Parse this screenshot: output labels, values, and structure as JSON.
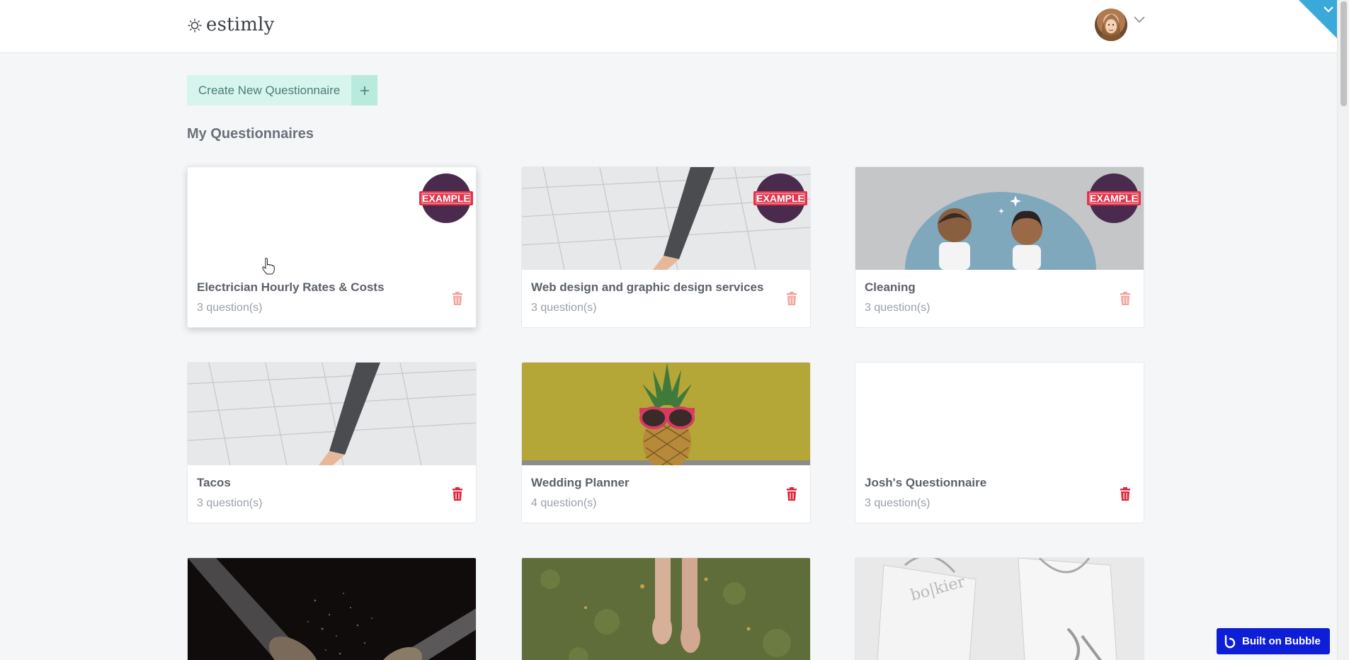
{
  "app": {
    "logo_text": "estimly",
    "logo_icon": "sun-icon"
  },
  "actions": {
    "create_label": "Create New Questionnaire",
    "create_icon": "plus-icon"
  },
  "section": {
    "title": "My Questionnaires"
  },
  "cards": [
    {
      "title": "Electrician Hourly Rates & Costs",
      "questions": "3  question(s)",
      "badge": "EXAMPLE",
      "image": "blank"
    },
    {
      "title": "Web design and graphic design services",
      "questions": "3  question(s)",
      "badge": "EXAMPLE",
      "image": "pencil-sketch"
    },
    {
      "title": "Cleaning",
      "questions": "3  question(s)",
      "badge": "EXAMPLE",
      "image": "cleaning-people"
    },
    {
      "title": "Tacos",
      "questions": "3  question(s)",
      "image": "pencil-sketch"
    },
    {
      "title": "Wedding Planner",
      "questions": "4  question(s)",
      "image": "pineapple-sunglasses"
    },
    {
      "title": "Josh's Questionnaire",
      "questions": "3  question(s)",
      "image": "blank"
    },
    {
      "image": "makeup-brushes"
    },
    {
      "image": "grass-feet"
    },
    {
      "image": "shopping-bags"
    }
  ],
  "footer": {
    "bubble_label": "Built on Bubble"
  },
  "colors": {
    "accent": "#d7f5ec",
    "accent_dark": "#b8ebdc",
    "delete": "#e2243a",
    "delete_faded": "#f3a6a0",
    "bubble": "#0d1ed6",
    "corner": "#3aa8d8"
  }
}
